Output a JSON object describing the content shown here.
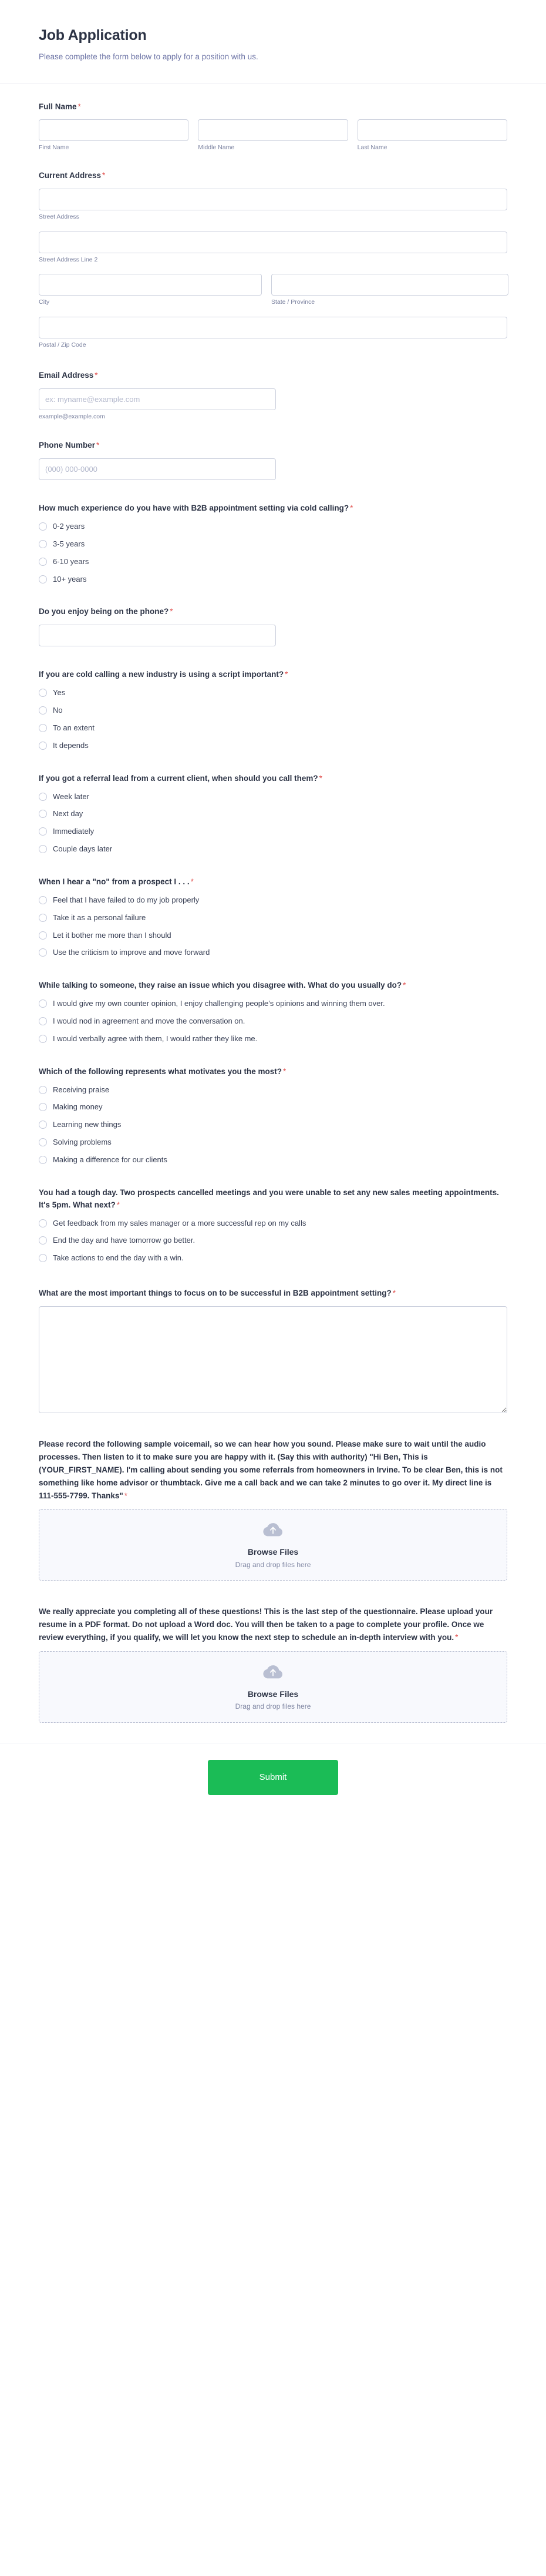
{
  "header": {
    "title": "Job Application",
    "subtitle": "Please complete the form below to apply for a position with us."
  },
  "required_mark": "*",
  "fields": {
    "full_name": {
      "label": "Full Name",
      "required": true,
      "parts": [
        {
          "sub_label": "First Name",
          "value": "",
          "placeholder": ""
        },
        {
          "sub_label": "Middle Name",
          "value": "",
          "placeholder": ""
        },
        {
          "sub_label": "Last Name",
          "value": "",
          "placeholder": ""
        }
      ]
    },
    "current_address": {
      "label": "Current Address",
      "required": true,
      "parts": [
        {
          "sub_label": "Street Address",
          "value": "",
          "placeholder": ""
        },
        {
          "sub_label": "Street Address Line 2",
          "value": "",
          "placeholder": ""
        },
        {
          "sub_label": "City",
          "value": "",
          "placeholder": ""
        },
        {
          "sub_label": "State / Province",
          "value": "",
          "placeholder": ""
        },
        {
          "sub_label": "Postal / Zip Code",
          "value": "",
          "placeholder": ""
        }
      ]
    },
    "email": {
      "label": "Email Address",
      "required": true,
      "placeholder": "ex: myname@example.com",
      "value": "",
      "sub_label": "example@example.com"
    },
    "phone": {
      "label": "Phone Number",
      "required": true,
      "placeholder": "(000) 000-0000",
      "value": ""
    },
    "enjoy_phone": {
      "label": "Do you enjoy being on the phone?",
      "required": true,
      "placeholder": "",
      "value": ""
    },
    "focus_text": {
      "label": "What are the most important things to focus on to be successful in B2B appointment setting?",
      "required": true,
      "placeholder": "",
      "value": ""
    }
  },
  "questions": [
    {
      "id": "experience",
      "label": "How much experience do you have with B2B appointment setting via cold calling?",
      "required": true,
      "options": [
        "0-2 years",
        "3-5 years",
        "6-10 years",
        "10+ years"
      ]
    },
    {
      "id": "script_important",
      "label": "If you are cold calling a new industry is using a script important?",
      "required": true,
      "options": [
        "Yes",
        "No",
        "To an extent",
        "It depends"
      ]
    },
    {
      "id": "referral_timing",
      "label": "If you got a referral lead from a current client, when should you call them?",
      "required": true,
      "options": [
        "Week later",
        "Next day",
        "Immediately",
        "Couple days later"
      ]
    },
    {
      "id": "hear_no",
      "label": "When I hear a \"no\" from a prospect I . . .",
      "required": true,
      "options": [
        "Feel that I have failed to do my job properly",
        "Take it as a personal failure",
        "Let it bother me more than I should",
        "Use the criticism to improve and move forward"
      ]
    },
    {
      "id": "disagreement",
      "label": "While talking to someone, they raise an issue which you disagree with. What do you usually do?",
      "required": true,
      "options": [
        "I would give my own counter opinion, I enjoy challenging people’s opinions and winning them over.",
        "I would nod in agreement and move the conversation on.",
        "I would verbally agree with them, I would rather they like me."
      ]
    },
    {
      "id": "motivation",
      "label": "Which of the following represents what motivates you the most?",
      "required": true,
      "options": [
        "Receiving praise",
        "Making money",
        "Learning new things",
        "Solving problems",
        "Making a difference for our clients"
      ]
    },
    {
      "id": "tough_day",
      "label": "You had a tough day. Two prospects cancelled meetings and you were unable to set any new sales meeting appointments. It's 5pm. What next?",
      "required": true,
      "options": [
        "Get feedback from my sales manager or a more successful rep on my calls",
        "End the day and have tomorrow go better.",
        "Take actions to end the day with a win."
      ]
    }
  ],
  "uploads": [
    {
      "id": "voicemail_upload",
      "label": "Please record the following sample voicemail, so we can hear how you sound. Please make sure to wait until the audio processes. Then listen to it to make sure you are happy with it. (Say this with authority) \"Hi Ben, This is (YOUR_FIRST_NAME). I'm calling about sending you some referrals from homeowners in Irvine. To be clear Ben, this is not something like home advisor or thumbtack. Give me a call back and we can take 2 minutes to go over it. My direct line is 111-555-7799. Thanks\"",
      "required": true,
      "browse_label": "Browse Files",
      "drop_label": "Drag and drop files here",
      "icon": "cloud-upload-icon"
    },
    {
      "id": "resume_upload",
      "label": "We really appreciate you completing all of these questions! This is the last step of the questionnaire. Please upload your resume in a PDF format. Do not upload a Word doc. You will then be taken to a page to complete your profile. Once we review everything, if you qualify, we will let you know the next step to schedule an in-depth interview with you.",
      "required": true,
      "browse_label": "Browse Files",
      "drop_label": "Drag and drop files here",
      "icon": "cloud-upload-icon"
    }
  ],
  "footer": {
    "submit_label": "Submit"
  },
  "colors": {
    "submit_green": "#1bbc56",
    "required_red": "#e1514f",
    "text_dark": "#2c3345",
    "text_muted": "#7a819f",
    "border": "#cbd0dd"
  }
}
